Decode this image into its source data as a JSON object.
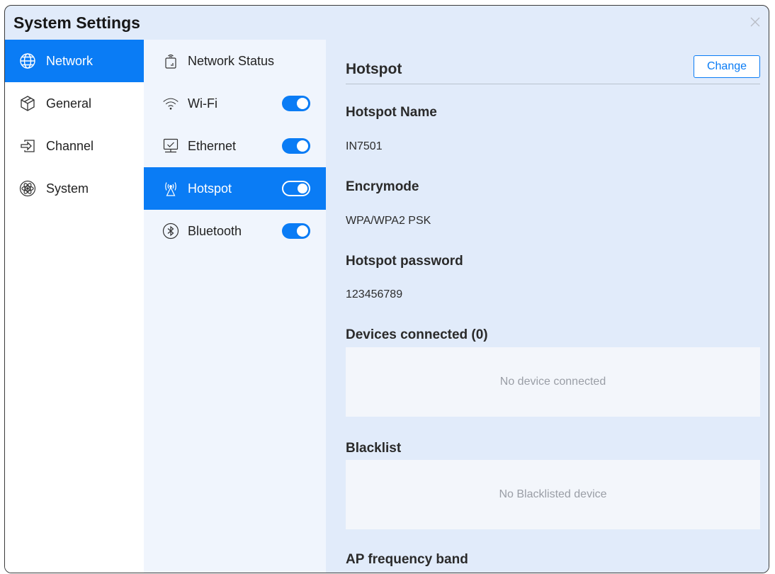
{
  "window": {
    "title": "System Settings"
  },
  "nav": {
    "items": [
      {
        "label": "Network",
        "icon": "globe-icon",
        "active": true
      },
      {
        "label": "General",
        "icon": "cube-icon",
        "active": false
      },
      {
        "label": "Channel",
        "icon": "input-arrow-icon",
        "active": false
      },
      {
        "label": "System",
        "icon": "atom-icon",
        "active": false
      }
    ]
  },
  "subnav": {
    "items": [
      {
        "label": "Network Status",
        "icon": "router-icon",
        "toggle": null,
        "active": false
      },
      {
        "label": "Wi-Fi",
        "icon": "wifi-icon",
        "toggle": true,
        "active": false
      },
      {
        "label": "Ethernet",
        "icon": "ethernet-icon",
        "toggle": true,
        "active": false
      },
      {
        "label": "Hotspot",
        "icon": "hotspot-icon",
        "toggle": true,
        "active": true
      },
      {
        "label": "Bluetooth",
        "icon": "bluetooth-icon",
        "toggle": true,
        "active": false
      }
    ]
  },
  "panel": {
    "title": "Hotspot",
    "change_label": "Change",
    "hotspot_name_label": "Hotspot Name",
    "hotspot_name_value": "IN7501",
    "encrymode_label": "Encrymode",
    "encrymode_value": "WPA/WPA2 PSK",
    "password_label": "Hotspot password",
    "password_value": "123456789",
    "devices_label": "Devices connected (0)",
    "devices_empty": "No device connected",
    "blacklist_label": "Blacklist",
    "blacklist_empty": "No Blacklisted device",
    "ap_band_label": "AP frequency band"
  },
  "colors": {
    "accent": "#0a7cf5",
    "panel_bg": "#e1ebfa",
    "subnav_bg": "#f0f5fd",
    "empty_text": "#9a9ea6"
  }
}
